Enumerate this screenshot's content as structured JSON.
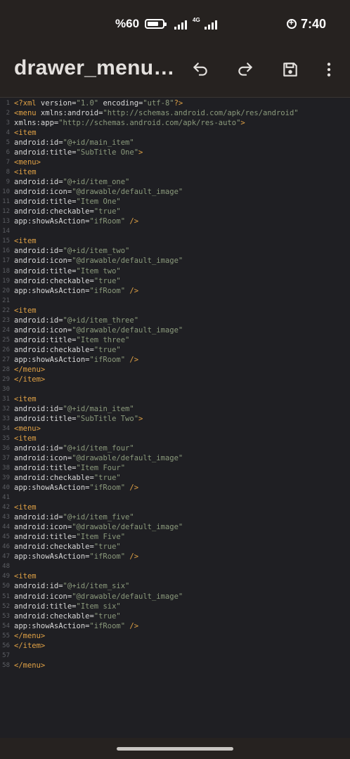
{
  "status_bar": {
    "battery_percent": "%60",
    "network": "4G",
    "time": "7:40"
  },
  "app_bar": {
    "title": "drawer_menu…",
    "icons": [
      "undo-icon",
      "redo-icon",
      "save-icon",
      "more-vert-icon"
    ]
  },
  "colors": {
    "background": "#1f1f23",
    "bar_background": "#262220",
    "tag": "#e0a145",
    "attribute": "#d8d8d8",
    "value": "#8b9a7c",
    "line_number": "#5c5e63"
  },
  "editor": {
    "lines": [
      {
        "n": "1",
        "segs": [
          [
            "t",
            "<?xml"
          ],
          [
            "a",
            " version="
          ],
          [
            "v",
            "\"1.0\""
          ],
          [
            "a",
            " encoding="
          ],
          [
            "v",
            "\"utf-8\""
          ],
          [
            "t",
            "?>"
          ]
        ]
      },
      {
        "n": "2",
        "segs": [
          [
            "t",
            "<menu"
          ],
          [
            "a",
            " xmlns:android="
          ],
          [
            "v",
            "\"http://schemas.android.com/apk/res/android\""
          ]
        ]
      },
      {
        "n": "3",
        "segs": [
          [
            "a",
            "xmlns:app="
          ],
          [
            "v",
            "\"http://schemas.android.com/apk/res-auto\""
          ],
          [
            "t",
            ">"
          ]
        ]
      },
      {
        "n": "4",
        "segs": [
          [
            "t",
            "<item"
          ]
        ]
      },
      {
        "n": "5",
        "segs": [
          [
            "a",
            "android:id="
          ],
          [
            "v",
            "\"@+id/main_item\""
          ]
        ]
      },
      {
        "n": "6",
        "segs": [
          [
            "a",
            "android:title="
          ],
          [
            "v",
            "\"SubTitle One\""
          ],
          [
            "t",
            ">"
          ]
        ]
      },
      {
        "n": "7",
        "segs": [
          [
            "t",
            "<menu>"
          ]
        ]
      },
      {
        "n": "8",
        "segs": [
          [
            "t",
            "<item"
          ]
        ]
      },
      {
        "n": "9",
        "segs": [
          [
            "a",
            "android:id="
          ],
          [
            "v",
            "\"@+id/item_one\""
          ]
        ]
      },
      {
        "n": "10",
        "segs": [
          [
            "a",
            "android:icon="
          ],
          [
            "v",
            "\"@drawable/default_image\""
          ]
        ]
      },
      {
        "n": "11",
        "segs": [
          [
            "a",
            "android:title="
          ],
          [
            "v",
            "\"Item One\""
          ]
        ]
      },
      {
        "n": "12",
        "segs": [
          [
            "a",
            "android:checkable="
          ],
          [
            "v",
            "\"true\""
          ]
        ]
      },
      {
        "n": "13",
        "segs": [
          [
            "a",
            "app:showAsAction="
          ],
          [
            "v",
            "\"ifRoom\""
          ],
          [
            "t",
            " />"
          ]
        ]
      },
      {
        "n": "14",
        "segs": []
      },
      {
        "n": "15",
        "segs": [
          [
            "t",
            "<item"
          ]
        ]
      },
      {
        "n": "16",
        "segs": [
          [
            "a",
            "android:id="
          ],
          [
            "v",
            "\"@+id/item_two\""
          ]
        ]
      },
      {
        "n": "17",
        "segs": [
          [
            "a",
            "android:icon="
          ],
          [
            "v",
            "\"@drawable/default_image\""
          ]
        ]
      },
      {
        "n": "18",
        "segs": [
          [
            "a",
            "android:title="
          ],
          [
            "v",
            "\"Item two\""
          ]
        ]
      },
      {
        "n": "19",
        "segs": [
          [
            "a",
            "android:checkable="
          ],
          [
            "v",
            "\"true\""
          ]
        ]
      },
      {
        "n": "20",
        "segs": [
          [
            "a",
            "app:showAsAction="
          ],
          [
            "v",
            "\"ifRoom\""
          ],
          [
            "t",
            " />"
          ]
        ]
      },
      {
        "n": "21",
        "segs": []
      },
      {
        "n": "22",
        "segs": [
          [
            "t",
            "<item"
          ]
        ]
      },
      {
        "n": "23",
        "segs": [
          [
            "a",
            "android:id="
          ],
          [
            "v",
            "\"@+id/item_three\""
          ]
        ]
      },
      {
        "n": "24",
        "segs": [
          [
            "a",
            "android:icon="
          ],
          [
            "v",
            "\"@drawable/default_image\""
          ]
        ]
      },
      {
        "n": "25",
        "segs": [
          [
            "a",
            "android:title="
          ],
          [
            "v",
            "\"Item three\""
          ]
        ]
      },
      {
        "n": "26",
        "segs": [
          [
            "a",
            "android:checkable="
          ],
          [
            "v",
            "\"true\""
          ]
        ]
      },
      {
        "n": "27",
        "segs": [
          [
            "a",
            "app:showAsAction="
          ],
          [
            "v",
            "\"ifRoom\""
          ],
          [
            "t",
            " />"
          ]
        ]
      },
      {
        "n": "28",
        "segs": [
          [
            "t",
            "</menu>"
          ]
        ]
      },
      {
        "n": "29",
        "segs": [
          [
            "t",
            "</item>"
          ]
        ]
      },
      {
        "n": "30",
        "segs": []
      },
      {
        "n": "31",
        "segs": [
          [
            "t",
            "<item"
          ]
        ]
      },
      {
        "n": "32",
        "segs": [
          [
            "a",
            "android:id="
          ],
          [
            "v",
            "\"@+id/main_item\""
          ]
        ]
      },
      {
        "n": "33",
        "segs": [
          [
            "a",
            "android:title="
          ],
          [
            "v",
            "\"SubTitle Two\""
          ],
          [
            "t",
            ">"
          ]
        ]
      },
      {
        "n": "34",
        "segs": [
          [
            "t",
            "<menu>"
          ]
        ]
      },
      {
        "n": "35",
        "segs": [
          [
            "t",
            "<item"
          ]
        ]
      },
      {
        "n": "36",
        "segs": [
          [
            "a",
            "android:id="
          ],
          [
            "v",
            "\"@+id/item_four\""
          ]
        ]
      },
      {
        "n": "37",
        "segs": [
          [
            "a",
            "android:icon="
          ],
          [
            "v",
            "\"@drawable/default_image\""
          ]
        ]
      },
      {
        "n": "38",
        "segs": [
          [
            "a",
            "android:title="
          ],
          [
            "v",
            "\"Item Four\""
          ]
        ]
      },
      {
        "n": "39",
        "segs": [
          [
            "a",
            "android:checkable="
          ],
          [
            "v",
            "\"true\""
          ]
        ]
      },
      {
        "n": "40",
        "segs": [
          [
            "a",
            "app:showAsAction="
          ],
          [
            "v",
            "\"ifRoom\""
          ],
          [
            "t",
            " />"
          ]
        ]
      },
      {
        "n": "41",
        "segs": []
      },
      {
        "n": "42",
        "segs": [
          [
            "t",
            "<item"
          ]
        ]
      },
      {
        "n": "43",
        "segs": [
          [
            "a",
            "android:id="
          ],
          [
            "v",
            "\"@+id/item_five\""
          ]
        ]
      },
      {
        "n": "44",
        "segs": [
          [
            "a",
            "android:icon="
          ],
          [
            "v",
            "\"@drawable/default_image\""
          ]
        ]
      },
      {
        "n": "45",
        "segs": [
          [
            "a",
            "android:title="
          ],
          [
            "v",
            "\"Item Five\""
          ]
        ]
      },
      {
        "n": "46",
        "segs": [
          [
            "a",
            "android:checkable="
          ],
          [
            "v",
            "\"true\""
          ]
        ]
      },
      {
        "n": "47",
        "segs": [
          [
            "a",
            "app:showAsAction="
          ],
          [
            "v",
            "\"ifRoom\""
          ],
          [
            "t",
            " />"
          ]
        ]
      },
      {
        "n": "48",
        "segs": []
      },
      {
        "n": "49",
        "segs": [
          [
            "t",
            "<item"
          ]
        ]
      },
      {
        "n": "50",
        "segs": [
          [
            "a",
            "android:id="
          ],
          [
            "v",
            "\"@+id/item_six\""
          ]
        ]
      },
      {
        "n": "51",
        "segs": [
          [
            "a",
            "android:icon="
          ],
          [
            "v",
            "\"@drawable/default_image\""
          ]
        ]
      },
      {
        "n": "52",
        "segs": [
          [
            "a",
            "android:title="
          ],
          [
            "v",
            "\"Item six\""
          ]
        ]
      },
      {
        "n": "53",
        "segs": [
          [
            "a",
            "android:checkable="
          ],
          [
            "v",
            "\"true\""
          ]
        ]
      },
      {
        "n": "54",
        "segs": [
          [
            "a",
            "app:showAsAction="
          ],
          [
            "v",
            "\"ifRoom\""
          ],
          [
            "t",
            " />"
          ]
        ]
      },
      {
        "n": "55",
        "segs": [
          [
            "t",
            "</menu>"
          ]
        ]
      },
      {
        "n": "56",
        "segs": [
          [
            "t",
            "</item>"
          ]
        ]
      },
      {
        "n": "57",
        "segs": []
      },
      {
        "n": "58",
        "segs": [
          [
            "t",
            "</menu>"
          ]
        ]
      }
    ]
  }
}
